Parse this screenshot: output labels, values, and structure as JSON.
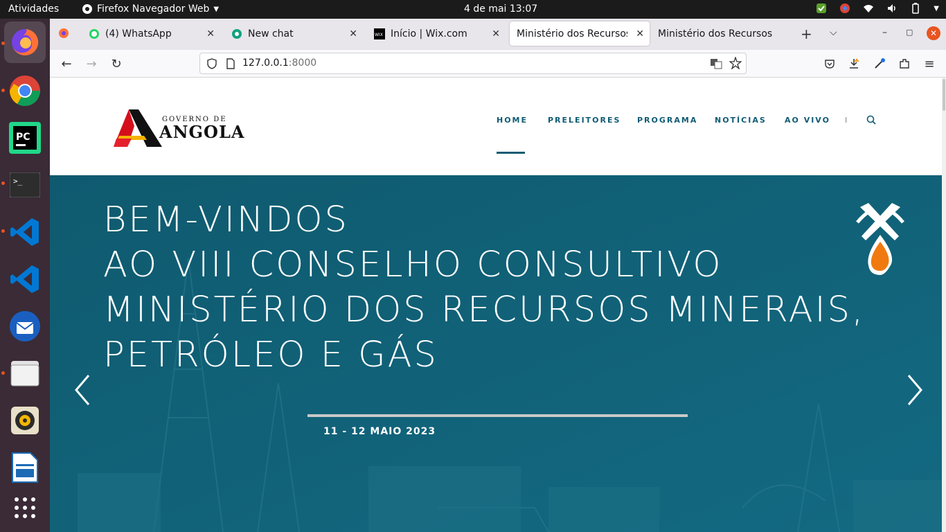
{
  "system": {
    "activities": "Atividades",
    "app_name": "Firefox Navegador Web",
    "clock": "4 de mai  13:07"
  },
  "browser": {
    "tabs": [
      {
        "label": "(4) WhatsApp",
        "icon": "whatsapp-icon"
      },
      {
        "label": "New chat",
        "icon": "openai-icon"
      },
      {
        "label": "Início | Wix.com",
        "icon": "wix-icon"
      },
      {
        "label": "Ministério dos Recursos M",
        "icon": "none",
        "selected": true
      },
      {
        "label": "Ministério dos Recursos M",
        "icon": "none"
      }
    ],
    "url_host": "127.0.0.1",
    "url_port": ":8000"
  },
  "site": {
    "logo_top": "GOVERNO DE",
    "logo_main": "ANGOLA",
    "nav": [
      "HOME",
      "PRELEITORES",
      "PROGRAMA",
      "NOTÍCIAS",
      "AO VIVO"
    ],
    "nav_separator": "I",
    "hero_lines": [
      "BEM-VINDOS",
      "AO VIII CONSELHO CONSULTIVO",
      "MINISTÉRIO DOS RECURSOS MINERAIS,",
      "PETRÓLEO E GÁS"
    ],
    "hero_date": "11 - 12 MAIO 2023"
  },
  "colors": {
    "hero_bg": "#115e74",
    "nav_text": "#0f5b73",
    "dock_bg": "#3a2b36",
    "accent": "#e95420"
  }
}
